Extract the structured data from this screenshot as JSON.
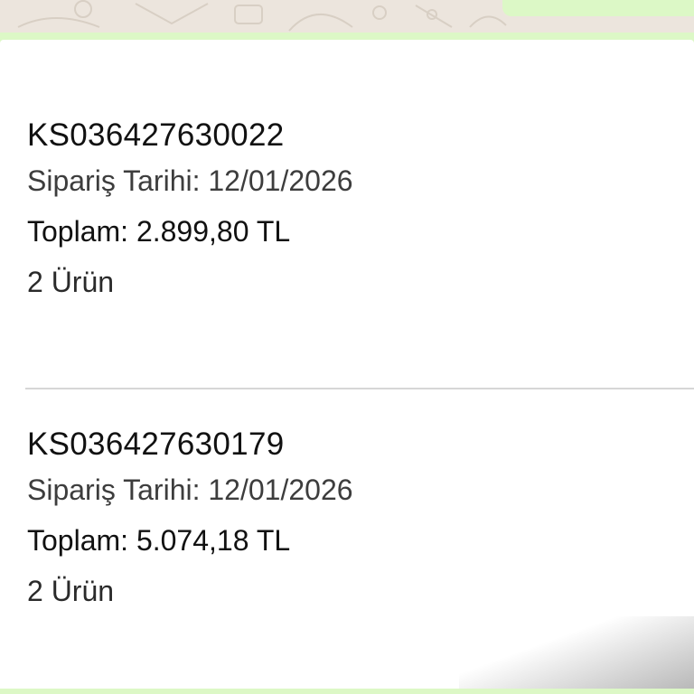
{
  "orders": [
    {
      "code": "KS036427630022",
      "date_line": "Sipariş Tarihi: 12/01/2026",
      "total_line": "Toplam: 2.899,80 TL",
      "count_line": "2 Ürün"
    },
    {
      "code": "KS036427630179",
      "date_line": "Sipariş Tarihi: 12/01/2026",
      "total_line": "Toplam: 5.074,18 TL",
      "count_line": "2 Ürün"
    }
  ],
  "colors": {
    "chat_background": "#ece5dd",
    "outgoing_bubble": "#dcf8c6",
    "divider": "#d6d6d6"
  }
}
